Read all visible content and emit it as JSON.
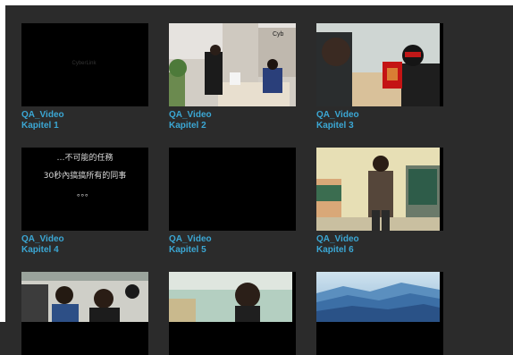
{
  "tiles": [
    {
      "title": "QA_Video",
      "chapter": "Kapitel 1",
      "thumb": "dark-logo-frame",
      "logo_text": "CyberLink"
    },
    {
      "title": "QA_Video",
      "chapter": "Kapitel 2",
      "thumb": "office-reception"
    },
    {
      "title": "QA_Video",
      "chapter": "Kapitel 3",
      "thumb": "helmet-red-envelope"
    },
    {
      "title": "QA_Video",
      "chapter": "Kapitel 4",
      "thumb": "subtitle-frame",
      "subtitle_line1": "…不可能的任務",
      "subtitle_line2": "30秒內搞搞所有的同事",
      "subtitle_line3": "。。。"
    },
    {
      "title": "QA_Video",
      "chapter": "Kapitel 5",
      "thumb": "black-frame"
    },
    {
      "title": "QA_Video",
      "chapter": "Kapitel 6",
      "thumb": "man-standing"
    },
    {
      "title": "",
      "chapter": "",
      "thumb": "two-men-office"
    },
    {
      "title": "",
      "chapter": "",
      "thumb": "man-glasses-closeup"
    },
    {
      "title": "",
      "chapter": "",
      "thumb": "blue-mountains"
    }
  ],
  "colors": {
    "background": "#2b2b2b",
    "caption": "#3ba7d4"
  }
}
